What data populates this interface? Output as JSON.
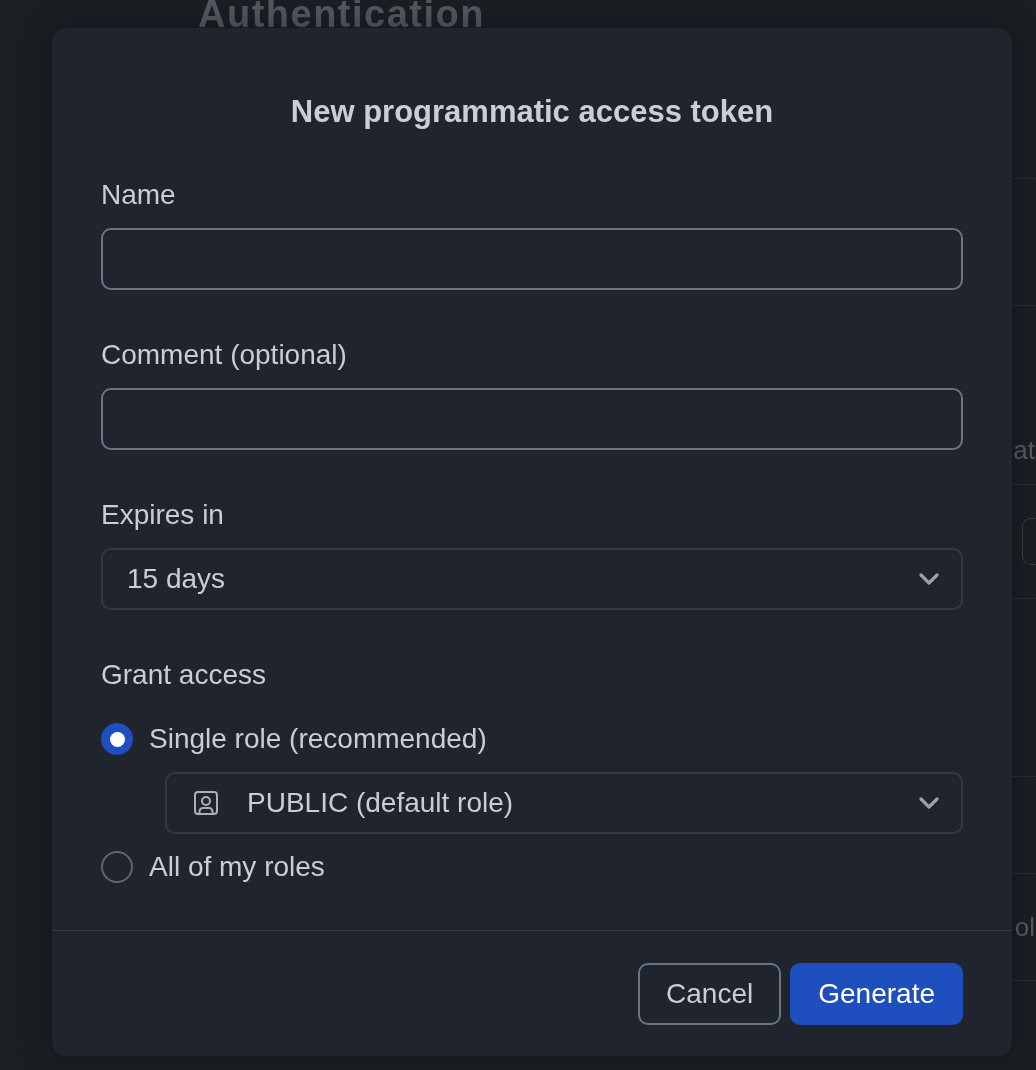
{
  "page": {
    "heading": "Authentication",
    "rows": [
      {
        "kind": "blank"
      },
      {
        "kind": "text",
        "text": "at"
      },
      {
        "kind": "button"
      },
      {
        "kind": "blank"
      },
      {
        "kind": "blank"
      },
      {
        "kind": "text",
        "text": "ol"
      },
      {
        "kind": "blank"
      }
    ]
  },
  "dialog": {
    "title": "New programmatic access token",
    "fields": [
      {
        "kind": "text",
        "label": "Name"
      },
      {
        "kind": "text",
        "label": "Comment (optional)"
      },
      {
        "kind": "select",
        "label": "Expires in",
        "value": "15 days"
      }
    ],
    "grant_access": {
      "label": "Grant access",
      "options": [
        {
          "label": "Single role (recommended)",
          "selected": true,
          "role": "PUBLIC (default role)"
        },
        {
          "label": "All of my roles",
          "selected": false
        }
      ]
    },
    "buttons": [
      {
        "kind": "secondary",
        "label": "Cancel"
      },
      {
        "kind": "primary",
        "label": "Generate"
      }
    ]
  }
}
